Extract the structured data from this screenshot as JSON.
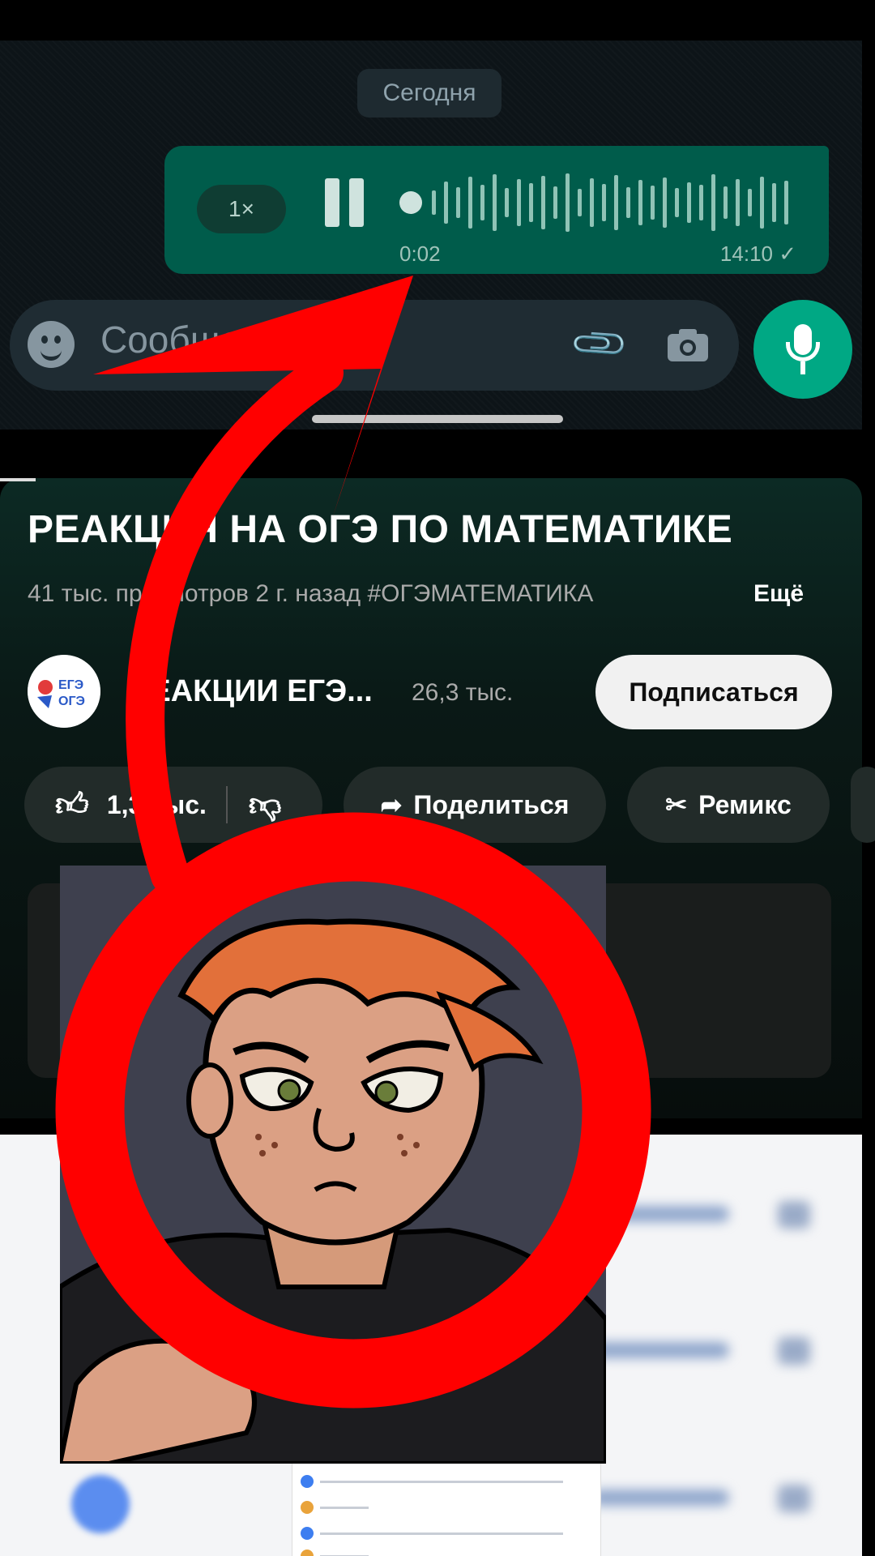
{
  "chat": {
    "date_label": "Сегодня",
    "voice_message": {
      "speed": "1×",
      "elapsed": "0:02",
      "sent_time": "14:10 ✓"
    },
    "input_placeholder": "Сообщение",
    "icons": [
      "emoji-icon",
      "paperclip-icon",
      "camera-icon",
      "microphone-icon"
    ]
  },
  "video": {
    "title": "РЕАКЦИЯ НА ОГЭ ПО МАТЕМАТИКЕ",
    "meta": "41 тыс. просмотров  2 г. назад  #ОГЭМАТЕМАТИКА",
    "more_label": "Ещё",
    "channel": {
      "avatar_text_top": "ЕГЭ",
      "avatar_text_bottom": "ОГЭ",
      "name": "РЕАКЦИИ ЕГЭ...",
      "subscribers": "26,3 тыс."
    },
    "subscribe_label": "Подписаться",
    "actions": {
      "likes": "1,3 тыс.",
      "share_label": "Поделиться",
      "remix_label": "Ремикс"
    }
  },
  "annotation": {
    "arrow_color": "#ff0000",
    "circle_color": "#ff0000"
  }
}
